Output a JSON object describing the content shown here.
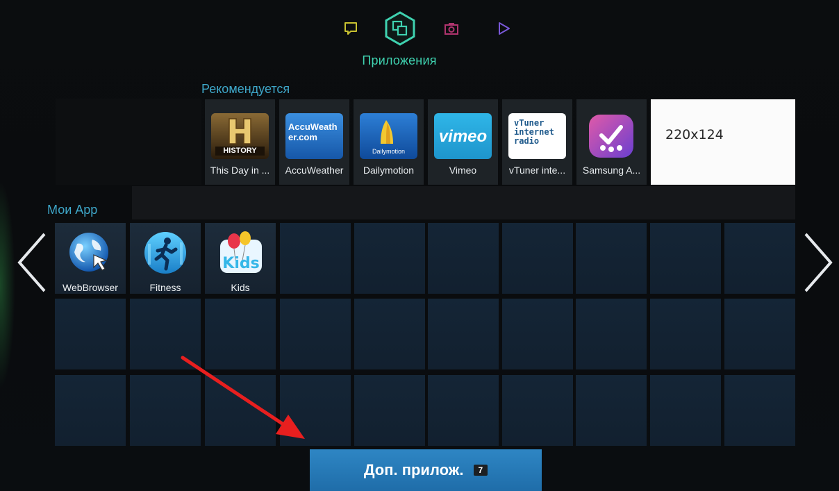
{
  "header": {
    "nav_icons": [
      {
        "name": "social-icon",
        "color": "#c9c230"
      },
      {
        "name": "apps-icon",
        "color": "#3fd2b0",
        "active": true
      },
      {
        "name": "photo-icon",
        "color": "#b0346e"
      },
      {
        "name": "play-icon",
        "color": "#7a58d8"
      }
    ],
    "section_title": "Приложения"
  },
  "recommended": {
    "title": "Рекомендуется",
    "tiles": [
      {
        "label": "This Day in ...",
        "logo": "history-logo",
        "logo_text": "HISTORY"
      },
      {
        "label": "AccuWeather",
        "logo": "accuweather-logo",
        "logo_text": "AccuWeather.com"
      },
      {
        "label": "Dailymotion",
        "logo": "dailymotion-logo",
        "logo_text": "Dailymotion"
      },
      {
        "label": "Vimeo",
        "logo": "vimeo-logo",
        "logo_text": "vimeo"
      },
      {
        "label": "vTuner inte...",
        "logo": "vtuner-logo",
        "logo_text": "vTuner internet radio"
      },
      {
        "label": "Samsung A...",
        "logo": "samsung-apps-logo"
      }
    ],
    "placeholder_text": "220x124"
  },
  "my_apps": {
    "title": "Мои App",
    "apps": [
      {
        "label": "WebBrowser",
        "icon": "web-browser-icon"
      },
      {
        "label": "Fitness",
        "icon": "fitness-icon"
      },
      {
        "label": "Kids",
        "icon": "kids-icon",
        "icon_text": "Kids"
      }
    ]
  },
  "footer": {
    "more_apps_label": "Доп. прилож.",
    "more_apps_count": "7"
  },
  "colors": {
    "accent_teal": "#3fd2b0",
    "heading_blue": "#3ea7c9",
    "button_blue": "#2679b8",
    "annotation_red": "#e81f1f"
  }
}
